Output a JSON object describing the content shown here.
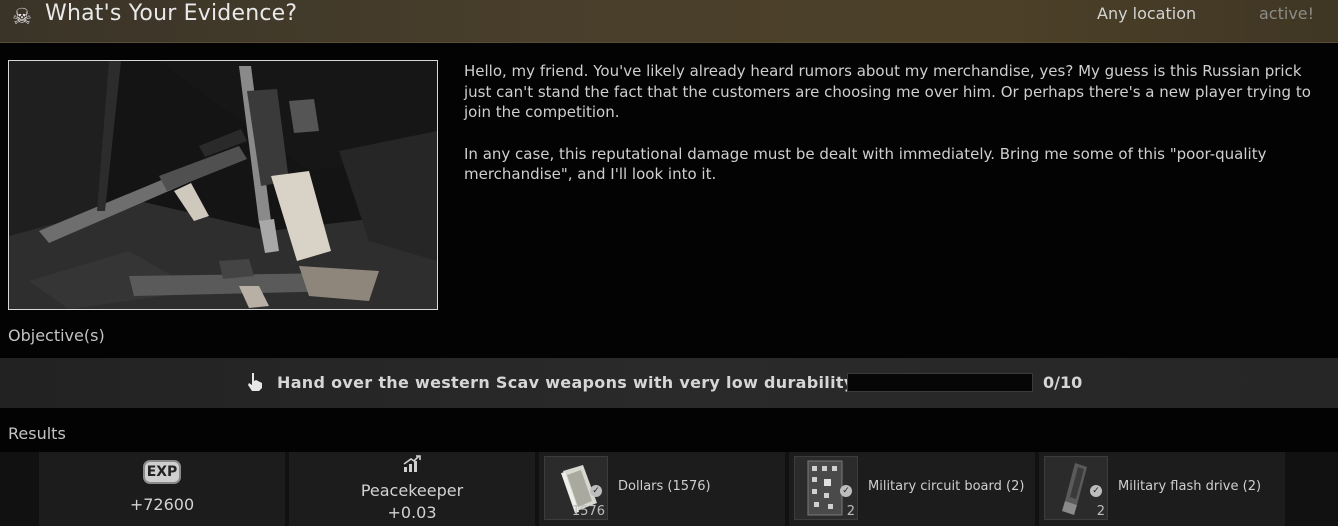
{
  "header": {
    "skull_icon": "skull-crossbones-icon",
    "title": "What's Your Evidence?",
    "location": "Any location",
    "status": "active!"
  },
  "description": {
    "paragraphs": [
      "Hello, my friend. You've likely already heard rumors about my merchandise, yes? My guess is this Russian prick just can't stand the fact that the customers are choosing me over him. Or perhaps there's a new player trying to join the competition.",
      "In any case, this reputational damage must be dealt with immediately. Bring me some of this \"poor-quality merchandise\", and I'll look into it."
    ]
  },
  "objectives": {
    "label": "Objective(s)",
    "items": [
      {
        "icon": "hand-pointer-icon",
        "text": "Hand over the western Scav weapons with very low durability",
        "count": "0/10",
        "progress": 0
      }
    ]
  },
  "results": {
    "label": "Results",
    "exp": {
      "badge": "EXP",
      "value": "+72600"
    },
    "reputation": {
      "icon": "reputation-chart-icon",
      "trader": "Peacekeeper",
      "value": "+0.03"
    },
    "items": [
      {
        "icon": "dollars-icon",
        "name": "Dollars (1576)",
        "qty": "1576"
      },
      {
        "icon": "circuit-board-icon",
        "name": "Military circuit board (2)",
        "qty": "2"
      },
      {
        "icon": "flash-drive-icon",
        "name": "Military flash drive (2)",
        "qty": "2"
      }
    ]
  },
  "colors": {
    "header_bg": "#4a3f2b",
    "background": "#030303",
    "objective_bar": "#262626",
    "reward_bg": "#1c1c1c"
  }
}
